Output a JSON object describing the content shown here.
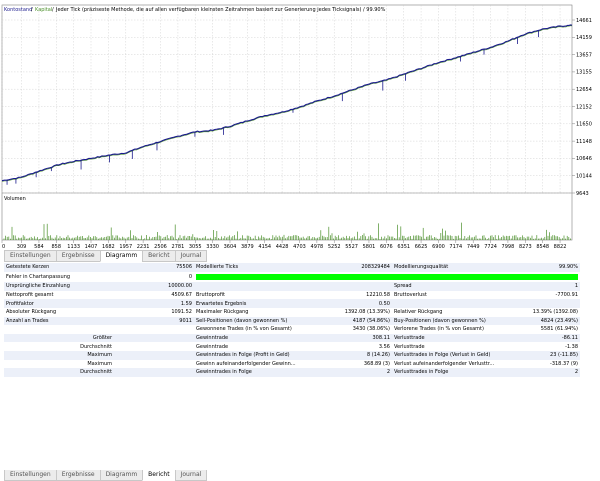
{
  "chart": {
    "header": {
      "title_kontostand": "Kontostand",
      "sep1": " / ",
      "title_kapital": "Kapital",
      "sep2": " / ",
      "description": "Jeder Tick (präziseste Methode, die auf allen verfügbaren kleinsten Zeitrahmen basiert zur Generierung jedes Ticksignals) / 99.90%"
    },
    "volume_label": "Volumen",
    "colors": {
      "balance": "#1a1a8c",
      "equity": "#4a8f2a",
      "green": "#00ff00",
      "grid": "#c8c8c8"
    }
  },
  "chart_data": {
    "type": "line",
    "y_ticks": [
      "14661",
      "14159",
      "13657",
      "13155",
      "12654",
      "12152",
      "11650",
      "11148",
      "10646",
      "10144",
      "9643"
    ],
    "ylim": [
      9643,
      14661
    ],
    "x_ticks": [
      "0",
      "309",
      "584",
      "858",
      "1133",
      "1407",
      "1682",
      "1957",
      "2231",
      "2506",
      "2781",
      "3055",
      "3330",
      "3604",
      "3879",
      "4154",
      "4428",
      "4703",
      "4978",
      "5252",
      "5527",
      "5801",
      "6076",
      "6351",
      "6625",
      "6900",
      "7174",
      "7449",
      "7724",
      "7998",
      "8273",
      "8548",
      "8822"
    ],
    "xlim": [
      0,
      9011
    ],
    "series": [
      {
        "x": [
          0,
          300,
          600,
          900,
          1133,
          1407,
          1682,
          1957,
          2231,
          2506,
          2781,
          3055,
          3330,
          3604,
          3879,
          4154,
          4428,
          4703,
          4978,
          5252,
          5527,
          5801,
          6076,
          6351,
          6625,
          6900,
          7174,
          7449,
          7724,
          7998,
          8273,
          8548,
          8822,
          9011
        ],
        "values": [
          10000,
          10100,
          10290,
          10470,
          10560,
          10650,
          10740,
          10810,
          10990,
          11140,
          11290,
          11420,
          11460,
          11580,
          11740,
          11890,
          11990,
          12140,
          12310,
          12460,
          12630,
          12800,
          12920,
          13090,
          13260,
          13430,
          13570,
          13720,
          13870,
          14050,
          14260,
          14400,
          14480,
          14510
        ]
      }
    ]
  },
  "tabs_top": [
    {
      "label": "Einstellungen",
      "active": false
    },
    {
      "label": "Ergebnisse",
      "active": false
    },
    {
      "label": "Diagramm",
      "active": true
    },
    {
      "label": "Bericht",
      "active": false
    },
    {
      "label": "Journal",
      "active": false
    }
  ],
  "tabs_bottom": [
    {
      "label": "Einstellungen",
      "active": false
    },
    {
      "label": "Ergebnisse",
      "active": false
    },
    {
      "label": "Diagramm",
      "active": false
    },
    {
      "label": "Bericht",
      "active": true
    },
    {
      "label": "Journal",
      "active": false
    }
  ],
  "report": {
    "bar_fraction": 0.999,
    "rows": [
      {
        "l1": "Getestete Kerzen",
        "v1": "75506",
        "l2": "Modellierte Ticks",
        "v2": "208329484",
        "l3": "Modellierungsqualität",
        "v3": "99.90%"
      },
      {
        "l1": "Fehler in Chartanpassung",
        "v1": "0",
        "bar": true
      },
      {
        "l1": "Ursprüngliche Einzahlung",
        "v1": "10000.00",
        "l2": "",
        "v2": "",
        "l3": "Spread",
        "v3": "1"
      },
      {
        "l1": "Nettoprofit gesamt",
        "v1": "4509.67",
        "l2": "Bruttoprofit",
        "v2": "12210.58",
        "l3": "Bruttoverlust",
        "v3": "-7700.91"
      },
      {
        "l1": "Profitfaktor",
        "v1": "1.59",
        "l2": "Erwartetes Ergebnis",
        "v2": "0.50",
        "l3": "",
        "v3": ""
      },
      {
        "l1": "Absoluter Rückgang",
        "v1": "1091.52",
        "l2": "Maximaler Rückgang",
        "v2": "1392.08 (13.39%)",
        "l3": "Relativer Rückgang",
        "v3": "13.39% (1392.08)"
      },
      {
        "l1": "Anzahl an Trades",
        "v1": "9011",
        "l2": "Sell-Positionen (davon gewonnen %)",
        "v2": "4187 (54.86%)",
        "l3": "Buy-Positionen (davon gewonnen %)",
        "v3": "4824 (23.49%)"
      },
      {
        "l1": "",
        "v1": "",
        "l2": "Gewonnene Trades (in % von Gesamt)",
        "v2": "3430 (38.06%)",
        "l3": "Verlorene Trades (in % von Gesamt)",
        "v3": "5581 (61.94%)"
      },
      {
        "l1": "Größter",
        "v1": "",
        "l2": "Gewinntrade",
        "v2": "308.11",
        "l3": "Verlusttrade",
        "v3": "-86.11",
        "rl": true
      },
      {
        "l1": "Durchschnitt",
        "v1": "",
        "l2": "Gewinntrade",
        "v2": "3.56",
        "l3": "Verlusttrade",
        "v3": "-1.38",
        "rl": true
      },
      {
        "l1": "Maximum",
        "v1": "",
        "l2": "Gewinntrades in Folge (Profit in Geld)",
        "v2": "8 (14.26)",
        "l3": "Verlusttrades in Folge (Verlust in Geld)",
        "v3": "23 (-11.85)",
        "rl": true
      },
      {
        "l1": "Maximum",
        "v1": "",
        "l2": "Gewinn aufeinanderfolgender Gewinn...",
        "v2": "368.89 (3)",
        "l3": "Verlust aufeinanderfolgender Verlusttr...",
        "v3": "-318.37 (9)",
        "rl": true
      },
      {
        "l1": "Durchschnitt",
        "v1": "",
        "l2": "Gewinntrades in Folge",
        "v2": "2",
        "l3": "Verlusttrades in Folge",
        "v3": "2",
        "rl": true
      }
    ]
  }
}
